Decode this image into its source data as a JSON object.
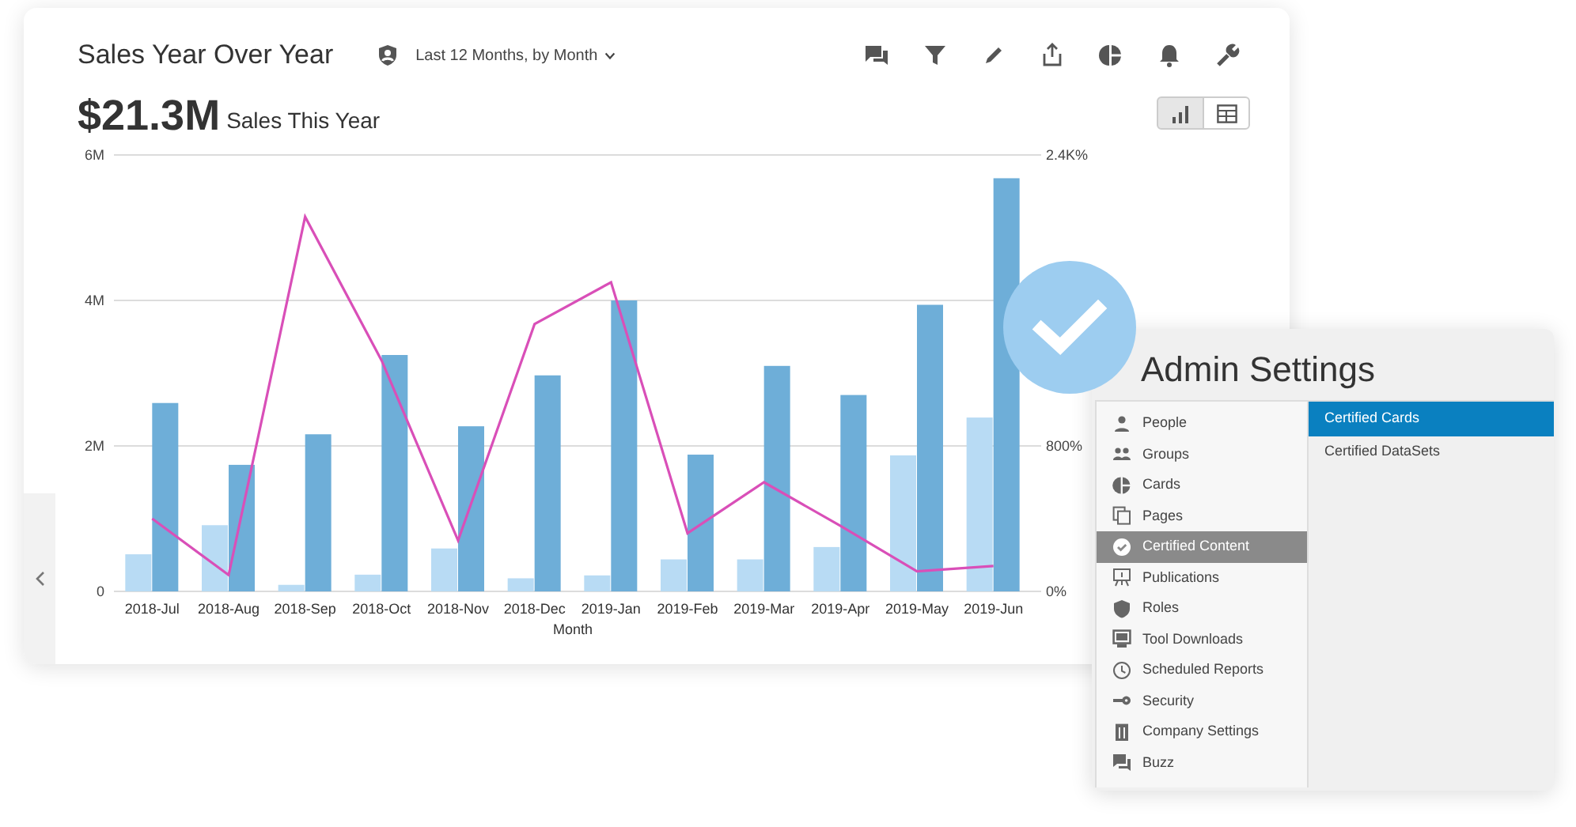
{
  "chart_card": {
    "title": "Sales Year Over Year",
    "filter": "Last 12 Months, by Month",
    "summary_value": "$21.3M",
    "summary_label": "Sales This Year",
    "view_toggle": [
      {
        "kind": "chart",
        "selected": true
      },
      {
        "kind": "table",
        "selected": false
      }
    ],
    "charts": [
      {
        "chart_data": {
          "type": "bar",
          "xlabel": "Month",
          "categories": [
            "2018-Jul",
            "2018-Aug",
            "2018-Sep",
            "2018-Oct",
            "2018-Nov",
            "2018-Dec",
            "2019-Jan",
            "2019-Feb",
            "2019-Mar",
            "2019-Apr",
            "2019-May",
            "2019-Jun"
          ],
          "series": [
            {
              "color": "#b8dbf4",
              "values": [
                510000,
                910000,
                90000,
                230000,
                590000,
                180000,
                220000,
                440000,
                440000,
                610000,
                1870000,
                2390000
              ]
            },
            {
              "color": "#6eaed8",
              "values": [
                2590000,
                1740000,
                2160000,
                3250000,
                2270000,
                2970000,
                4000000,
                1880000,
                3100000,
                2700000,
                3940000,
                5680000
              ]
            }
          ],
          "ylim": [
            0,
            6000000
          ],
          "yticks": [
            {
              "value": 0,
              "label": "0"
            },
            {
              "value": 2000000,
              "label": "2M"
            },
            {
              "value": 4000000,
              "label": "4M"
            },
            {
              "value": 6000000,
              "label": "6M"
            }
          ]
        }
      },
      {
        "chart_data": {
          "type": "line",
          "series": [
            {
              "color": "#d94fb8",
              "values": [
                400,
                90,
                2060,
                1270,
                280,
                1470,
                1700,
                320,
                600,
                360,
                110,
                140
              ]
            }
          ],
          "ylim": [
            0,
            2400
          ],
          "yticks": [
            {
              "value": 0,
              "label": "0%"
            },
            {
              "value": 800,
              "label": "800%"
            },
            {
              "value": 2400,
              "label": "2.4K%"
            }
          ]
        }
      }
    ]
  },
  "admin_settings": {
    "title": "Admin Settings",
    "menu": [
      {
        "label": "People",
        "selected": false
      },
      {
        "label": "Groups",
        "selected": false
      },
      {
        "label": "Cards",
        "selected": false
      },
      {
        "label": "Pages",
        "selected": false
      },
      {
        "label": "Certified Content",
        "selected": true
      },
      {
        "label": "Publications",
        "selected": false
      },
      {
        "label": "Roles",
        "selected": false
      },
      {
        "label": "Tool Downloads",
        "selected": false
      },
      {
        "label": "Scheduled Reports",
        "selected": false
      },
      {
        "label": "Security",
        "selected": false
      },
      {
        "label": "Company Settings",
        "selected": false
      },
      {
        "label": "Buzz",
        "selected": false
      }
    ],
    "submenu": [
      {
        "label": "Certified Cards",
        "selected": true
      },
      {
        "label": "Certified DataSets",
        "selected": false
      }
    ]
  }
}
